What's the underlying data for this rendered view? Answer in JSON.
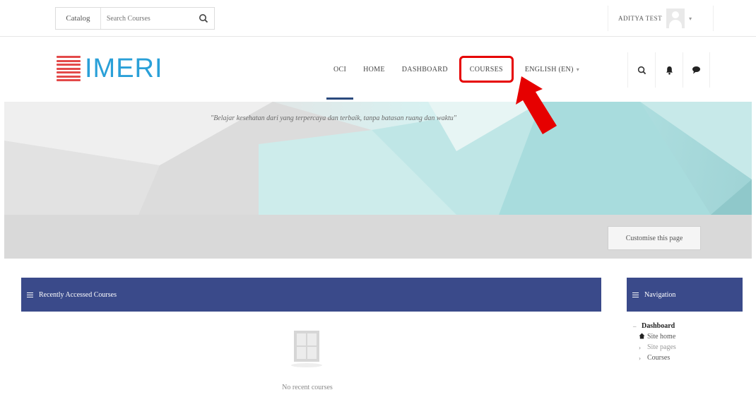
{
  "topbar": {
    "catalog_label": "Catalog",
    "search_placeholder": "Search Courses",
    "user_name": "ADITYA TEST"
  },
  "header": {
    "logo_text": "IMERI",
    "nav": [
      {
        "label": "OCI"
      },
      {
        "label": "HOME"
      },
      {
        "label": "DASHBOARD"
      },
      {
        "label": "COURSES"
      },
      {
        "label": "ENGLISH (EN)"
      }
    ],
    "icons": [
      "search-icon",
      "bell-icon",
      "chat-icon"
    ]
  },
  "banner": {
    "quote": "\"Belajar kesehatan dari yang terpercaya dan terbaik, tanpa batasan ruang dan waktu\""
  },
  "page": {
    "customise_label": "Customise this page"
  },
  "recent": {
    "title": "Recently Accessed Courses",
    "empty_text": "No recent courses"
  },
  "navigation": {
    "title": "Navigation",
    "items": [
      {
        "label": "Dashboard"
      },
      {
        "label": "Site home"
      },
      {
        "label": "Site pages"
      },
      {
        "label": "Courses"
      }
    ]
  },
  "colors": {
    "block_header": "#3a4a8a",
    "highlight": "#e60000",
    "logo": "#2aa0d8"
  }
}
